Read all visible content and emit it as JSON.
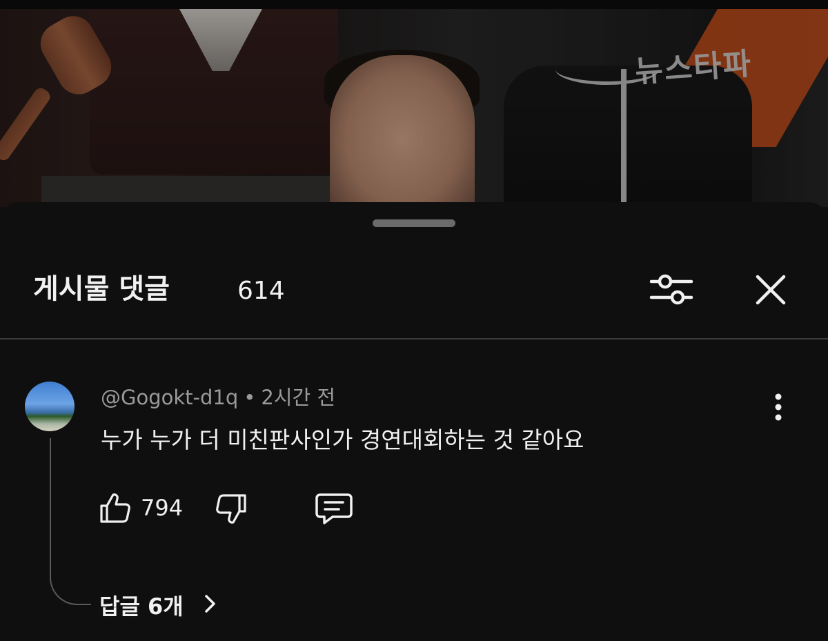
{
  "video": {
    "brand_text": "뉴스타파"
  },
  "sheet": {
    "title": "게시물 댓글",
    "count": "614",
    "filter_icon": "sliders-icon",
    "close_icon": "close-icon"
  },
  "comment": {
    "author": "@Gogokt-d1q",
    "separator": "•",
    "time": "2시간 전",
    "text": "누가 누가 더 미친판사인가 경연대회하는 것 같아요",
    "likes": "794",
    "replies_label": "답글 6개",
    "replies_chevron": "›"
  },
  "colors": {
    "background": "#0f0f0f",
    "text": "#f1f1f1",
    "muted": "#9a9a9a",
    "divider": "#3d3d3d"
  }
}
